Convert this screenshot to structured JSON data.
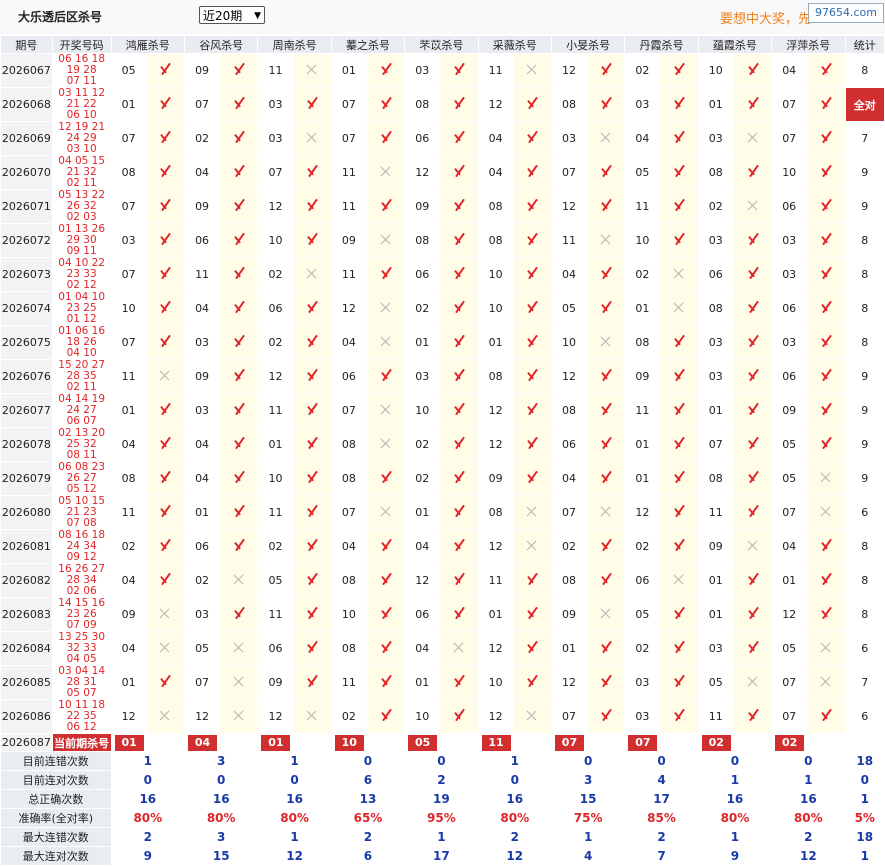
{
  "header": {
    "title": "大乐透后区杀号",
    "period_select": "近20期",
    "slogan": "要想中大奖，先",
    "site": "97654.com"
  },
  "columns": {
    "issue": "期号",
    "draw": "开奖号码",
    "experts": [
      "鸿雁杀号",
      "谷风杀号",
      "周南杀号",
      "蓁之杀号",
      "芣苡杀号",
      "采薇杀号",
      "小旻杀号",
      "丹霞杀号",
      "蕴霞杀号",
      "浮萍杀号"
    ],
    "count": "统计"
  },
  "rows": [
    {
      "issue": "2026067",
      "draw1": "06 16 18 19 28",
      "draw2": "07 11",
      "picks": [
        "05",
        "09",
        "11",
        "01",
        "03",
        "11",
        "12",
        "02",
        "10",
        "04"
      ],
      "marks": [
        1,
        1,
        0,
        1,
        1,
        0,
        1,
        1,
        1,
        1
      ],
      "count": "8"
    },
    {
      "issue": "2026068",
      "draw1": "03 11 12 21 22",
      "draw2": "06 10",
      "picks": [
        "01",
        "07",
        "03",
        "07",
        "08",
        "12",
        "08",
        "03",
        "01",
        "07"
      ],
      "marks": [
        1,
        1,
        1,
        1,
        1,
        1,
        1,
        1,
        1,
        1
      ],
      "count": "全对"
    },
    {
      "issue": "2026069",
      "draw1": "12 19 21 24 29",
      "draw2": "03 10",
      "picks": [
        "07",
        "02",
        "03",
        "07",
        "06",
        "04",
        "03",
        "04",
        "03",
        "07"
      ],
      "marks": [
        1,
        1,
        0,
        1,
        1,
        1,
        0,
        1,
        0,
        1
      ],
      "count": "7"
    },
    {
      "issue": "2026070",
      "draw1": "04 05 15 21 32",
      "draw2": "02 11",
      "picks": [
        "08",
        "04",
        "07",
        "11",
        "12",
        "04",
        "07",
        "05",
        "08",
        "10"
      ],
      "marks": [
        1,
        1,
        1,
        0,
        1,
        1,
        1,
        1,
        1,
        1
      ],
      "count": "9"
    },
    {
      "issue": "2026071",
      "draw1": "05 13 22 26 32",
      "draw2": "02 03",
      "picks": [
        "07",
        "09",
        "12",
        "11",
        "09",
        "08",
        "12",
        "11",
        "02",
        "06"
      ],
      "marks": [
        1,
        1,
        1,
        1,
        1,
        1,
        1,
        1,
        0,
        1
      ],
      "count": "9"
    },
    {
      "issue": "2026072",
      "draw1": "01 13 26 29 30",
      "draw2": "09 11",
      "picks": [
        "03",
        "06",
        "10",
        "09",
        "08",
        "08",
        "11",
        "10",
        "03",
        "03"
      ],
      "marks": [
        1,
        1,
        1,
        0,
        1,
        1,
        0,
        1,
        1,
        1
      ],
      "count": "8"
    },
    {
      "issue": "2026073",
      "draw1": "04 10 22 23 33",
      "draw2": "02 12",
      "picks": [
        "07",
        "11",
        "02",
        "11",
        "06",
        "10",
        "04",
        "02",
        "06",
        "03"
      ],
      "marks": [
        1,
        1,
        0,
        1,
        1,
        1,
        1,
        0,
        1,
        1
      ],
      "count": "8"
    },
    {
      "issue": "2026074",
      "draw1": "01 04 10 23 25",
      "draw2": "01 12",
      "picks": [
        "10",
        "04",
        "06",
        "12",
        "02",
        "10",
        "05",
        "01",
        "08",
        "06"
      ],
      "marks": [
        1,
        1,
        1,
        0,
        1,
        1,
        1,
        0,
        1,
        1
      ],
      "count": "8"
    },
    {
      "issue": "2026075",
      "draw1": "01 06 16 18 26",
      "draw2": "04 10",
      "picks": [
        "07",
        "03",
        "02",
        "04",
        "01",
        "01",
        "10",
        "08",
        "03",
        "03"
      ],
      "marks": [
        1,
        1,
        1,
        0,
        1,
        1,
        0,
        1,
        1,
        1
      ],
      "count": "8"
    },
    {
      "issue": "2026076",
      "draw1": "15 20 27 28 35",
      "draw2": "02 11",
      "picks": [
        "11",
        "09",
        "12",
        "06",
        "03",
        "08",
        "12",
        "09",
        "03",
        "06"
      ],
      "marks": [
        0,
        1,
        1,
        1,
        1,
        1,
        1,
        1,
        1,
        1
      ],
      "count": "9"
    },
    {
      "issue": "2026077",
      "draw1": "04 14 19 24 27",
      "draw2": "06 07",
      "picks": [
        "01",
        "03",
        "11",
        "07",
        "10",
        "12",
        "08",
        "11",
        "01",
        "09"
      ],
      "marks": [
        1,
        1,
        1,
        0,
        1,
        1,
        1,
        1,
        1,
        1
      ],
      "count": "9"
    },
    {
      "issue": "2026078",
      "draw1": "02 13 20 25 32",
      "draw2": "08 11",
      "picks": [
        "04",
        "04",
        "01",
        "08",
        "02",
        "12",
        "06",
        "01",
        "07",
        "05"
      ],
      "marks": [
        1,
        1,
        1,
        0,
        1,
        1,
        1,
        1,
        1,
        1
      ],
      "count": "9"
    },
    {
      "issue": "2026079",
      "draw1": "06 08 23 26 27",
      "draw2": "05 12",
      "picks": [
        "08",
        "04",
        "10",
        "08",
        "02",
        "09",
        "04",
        "01",
        "08",
        "05"
      ],
      "marks": [
        1,
        1,
        1,
        1,
        1,
        1,
        1,
        1,
        1,
        0
      ],
      "count": "9"
    },
    {
      "issue": "2026080",
      "draw1": "05 10 15 21 23",
      "draw2": "07 08",
      "picks": [
        "11",
        "01",
        "11",
        "07",
        "01",
        "08",
        "07",
        "12",
        "11",
        "07"
      ],
      "marks": [
        1,
        1,
        1,
        0,
        1,
        0,
        0,
        1,
        1,
        0
      ],
      "count": "6"
    },
    {
      "issue": "2026081",
      "draw1": "08 16 18 24 34",
      "draw2": "09 12",
      "picks": [
        "02",
        "06",
        "02",
        "04",
        "04",
        "12",
        "02",
        "02",
        "09",
        "04"
      ],
      "marks": [
        1,
        1,
        1,
        1,
        1,
        0,
        1,
        1,
        0,
        1
      ],
      "count": "8"
    },
    {
      "issue": "2026082",
      "draw1": "16 26 27 28 34",
      "draw2": "02 06",
      "picks": [
        "04",
        "02",
        "05",
        "08",
        "12",
        "11",
        "08",
        "06",
        "01",
        "01"
      ],
      "marks": [
        1,
        0,
        1,
        1,
        1,
        1,
        1,
        0,
        1,
        1
      ],
      "count": "8"
    },
    {
      "issue": "2026083",
      "draw1": "14 15 16 23 26",
      "draw2": "07 09",
      "picks": [
        "09",
        "03",
        "11",
        "10",
        "06",
        "01",
        "09",
        "05",
        "01",
        "12"
      ],
      "marks": [
        0,
        1,
        1,
        1,
        1,
        1,
        0,
        1,
        1,
        1
      ],
      "count": "8"
    },
    {
      "issue": "2026084",
      "draw1": "13 25 30 32 33",
      "draw2": "04 05",
      "picks": [
        "04",
        "05",
        "06",
        "08",
        "04",
        "12",
        "01",
        "02",
        "03",
        "05"
      ],
      "marks": [
        0,
        0,
        1,
        1,
        0,
        1,
        1,
        1,
        1,
        0
      ],
      "count": "6"
    },
    {
      "issue": "2026085",
      "draw1": "03 04 14 28 31",
      "draw2": "05 07",
      "picks": [
        "01",
        "07",
        "09",
        "11",
        "01",
        "10",
        "12",
        "03",
        "05",
        "07"
      ],
      "marks": [
        1,
        0,
        1,
        1,
        1,
        1,
        1,
        1,
        0,
        0
      ],
      "count": "7"
    },
    {
      "issue": "2026086",
      "draw1": "10 11 18 22 35",
      "draw2": "06 12",
      "picks": [
        "12",
        "12",
        "12",
        "02",
        "10",
        "12",
        "07",
        "03",
        "11",
        "07"
      ],
      "marks": [
        0,
        0,
        0,
        1,
        1,
        0,
        1,
        1,
        1,
        1
      ],
      "count": "6"
    }
  ],
  "current": {
    "issue": "2026087",
    "label": "当前期杀号",
    "picks": [
      "01",
      "04",
      "01",
      "10",
      "05",
      "11",
      "07",
      "07",
      "02",
      "02"
    ]
  },
  "stats": [
    {
      "label": "目前连错次数",
      "values": [
        "1",
        "3",
        "1",
        "0",
        "0",
        "1",
        "0",
        "0",
        "0",
        "0"
      ],
      "count": "18",
      "red": false
    },
    {
      "label": "目前连对次数",
      "values": [
        "0",
        "0",
        "0",
        "6",
        "2",
        "0",
        "3",
        "4",
        "1",
        "1"
      ],
      "count": "0",
      "red": false
    },
    {
      "label": "总正确次数",
      "values": [
        "16",
        "16",
        "16",
        "13",
        "19",
        "16",
        "15",
        "17",
        "16",
        "16"
      ],
      "count": "1",
      "red": false
    },
    {
      "label": "准确率(全对率)",
      "values": [
        "80%",
        "80%",
        "80%",
        "65%",
        "95%",
        "80%",
        "75%",
        "85%",
        "80%",
        "80%"
      ],
      "count": "5%",
      "red": true
    },
    {
      "label": "最大连错次数",
      "values": [
        "2",
        "3",
        "1",
        "2",
        "1",
        "2",
        "1",
        "2",
        "1",
        "2"
      ],
      "count": "18",
      "red": false
    },
    {
      "label": "最大连对次数",
      "values": [
        "9",
        "15",
        "12",
        "6",
        "17",
        "12",
        "4",
        "7",
        "9",
        "12"
      ],
      "count": "1",
      "red": false
    }
  ]
}
